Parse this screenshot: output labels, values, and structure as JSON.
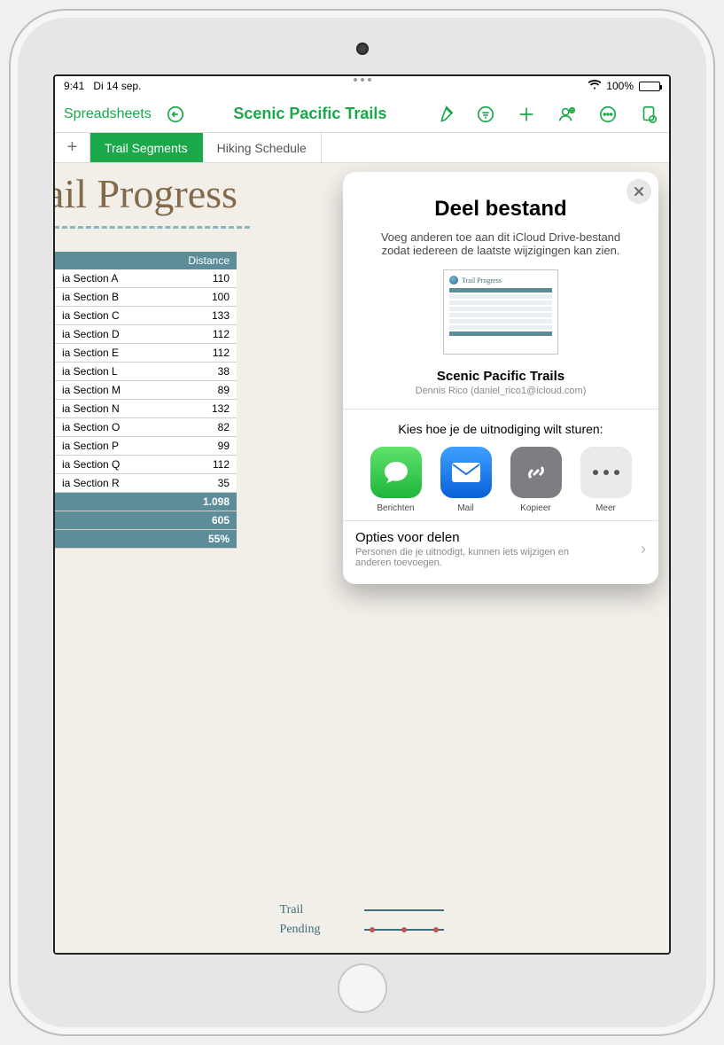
{
  "status_bar": {
    "time": "9:41",
    "date": "Di 14 sep.",
    "battery_pct": "100%"
  },
  "toolbar": {
    "back_label": "Spreadsheets",
    "document_title": "Scenic Pacific Trails"
  },
  "tabs": {
    "active": "Trail Segments",
    "inactive": "Hiking Schedule"
  },
  "sheet": {
    "title": "ail Progress",
    "distance_header": "Distance",
    "rows": [
      {
        "name": "ia Section A",
        "distance": "110"
      },
      {
        "name": "ia Section B",
        "distance": "100"
      },
      {
        "name": "ia Section C",
        "distance": "133"
      },
      {
        "name": "ia Section D",
        "distance": "112"
      },
      {
        "name": "ia Section E",
        "distance": "112"
      },
      {
        "name": "ia Section L",
        "distance": "38"
      },
      {
        "name": "ia Section M",
        "distance": "89"
      },
      {
        "name": "ia Section N",
        "distance": "132"
      },
      {
        "name": "ia Section O",
        "distance": "82"
      },
      {
        "name": "ia Section P",
        "distance": "99"
      },
      {
        "name": "ia Section Q",
        "distance": "112"
      },
      {
        "name": "ia Section R",
        "distance": "35"
      }
    ],
    "summary": [
      {
        "value": "1.098"
      },
      {
        "value": "605"
      },
      {
        "value": "55%"
      }
    ],
    "legend": {
      "label1": "Trail",
      "label2": "Pending"
    }
  },
  "popover": {
    "title": "Deel bestand",
    "subtitle": "Voeg anderen toe aan dit iCloud Drive-bestand zodat iedereen de laatste wijzigingen kan zien.",
    "thumb_title": "Trail Progress",
    "file_name": "Scenic Pacific Trails",
    "file_owner": "Dennis Rico (daniel_rico1@icloud.com)",
    "send_prompt": "Kies hoe je de uitnodiging wilt sturen:",
    "send_options": {
      "messages": "Berichten",
      "mail": "Mail",
      "copy": "Kopieer",
      "more": "Meer"
    },
    "share_options": {
      "title": "Opties voor delen",
      "subtitle": "Personen die je uitnodigt, kunnen iets wijzigen en anderen toevoegen."
    }
  }
}
